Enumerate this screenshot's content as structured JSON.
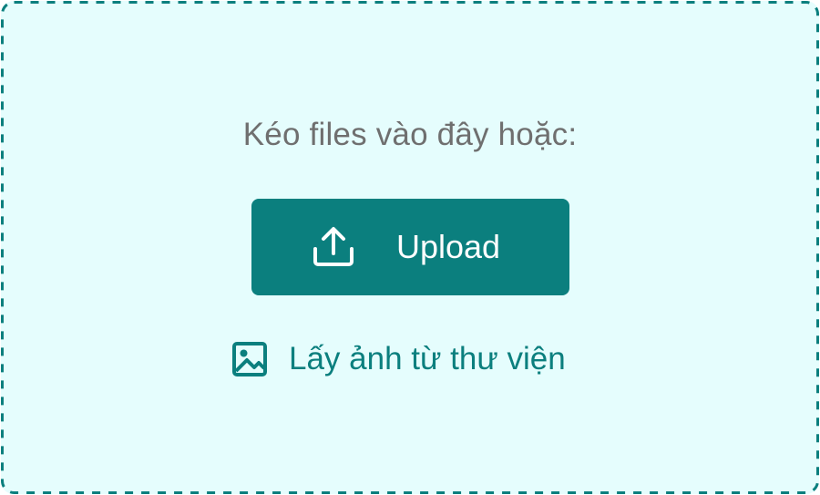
{
  "dropzone": {
    "prompt": "Kéo files vào đây hoặc:",
    "upload_button": {
      "label": "Upload",
      "icon": "upload-icon"
    },
    "library_link": {
      "label": "Lấy ảnh từ thư viện",
      "icon": "image-icon"
    }
  },
  "colors": {
    "background": "#e5fdfd",
    "accent": "#0b7f7e",
    "prompt_text": "#6f6f6f",
    "button_text": "#ffffff"
  }
}
